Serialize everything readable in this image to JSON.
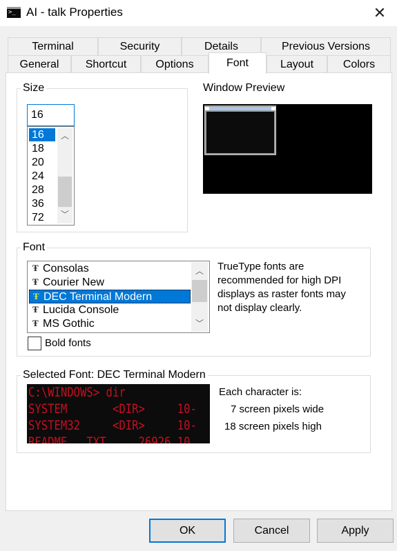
{
  "window": {
    "title": "AI - talk Properties",
    "icon_name": "console-icon",
    "icon_text": ">_",
    "close_glyph": "✕"
  },
  "tabs": {
    "row1": [
      "Terminal",
      "Security",
      "Details",
      "Previous Versions"
    ],
    "row2": [
      "General",
      "Shortcut",
      "Options",
      "Font",
      "Layout",
      "Colors"
    ],
    "active": "Font"
  },
  "size_group": {
    "label": "Size",
    "input_value": "16",
    "options": [
      "16",
      "18",
      "20",
      "24",
      "28",
      "36",
      "72"
    ],
    "selected": "16"
  },
  "preview": {
    "label": "Window Preview"
  },
  "font_group": {
    "label": "Font",
    "tt_glyph": "Ŧ",
    "fonts": [
      "Consolas",
      "Courier New",
      "DEC Terminal Modern",
      "Lucida Console",
      "MS Gothic"
    ],
    "selected": "DEC Terminal Modern",
    "info_lines": [
      "TrueType fonts are",
      "recommended for high DPI",
      "displays as raster fonts may",
      "not display clearly."
    ],
    "bold_label": "Bold fonts",
    "bold_checked": false
  },
  "selected_font": {
    "label": "Selected Font: DEC Terminal Modern",
    "sample_lines": [
      "C:\\WINDOWS> dir",
      "SYSTEM       <DIR>     10-",
      "SYSTEM32     <DIR>     10-",
      "README   TXT     26926 10"
    ],
    "char_heading": "Each character is:",
    "char_width": "7 screen pixels wide",
    "char_height": "18 screen pixels high"
  },
  "buttons": {
    "ok": "OK",
    "cancel": "Cancel",
    "apply": "Apply"
  },
  "colors": {
    "accent": "#0078d7",
    "console_bg": "#0c0c0c",
    "console_text": "#c50f1f"
  }
}
